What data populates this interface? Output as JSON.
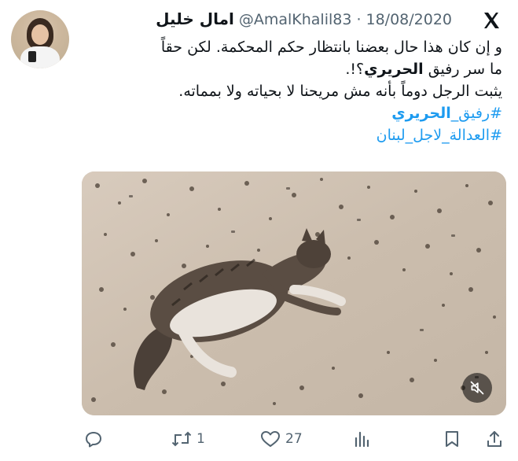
{
  "tweet": {
    "display_name": "امال خليل",
    "handle": "@AmalKhalil83",
    "separator": "·",
    "date": "18/08/2020",
    "text_line1": "و إن كان هذا حال بعضنا بانتظار حكم المحكمة. لكن حقاً",
    "text_line2_pre": "ما سر رفيق ",
    "text_line2_bold": "الحريري",
    "text_line2_post": "؟!.",
    "text_line3": "يثبت الرجل دوماً بأنه مش مريحنا لا بحياته ولا بمماته.",
    "hashtag1_pre": "#رفيق_",
    "hashtag1_bold": "الحريري",
    "hashtag2": "#العدالة_لاجل_لبنان"
  },
  "actions": {
    "reply_count": "",
    "retweet_count": "1",
    "like_count": "27"
  },
  "icons": {
    "logo": "x-logo-icon",
    "mute": "volume-mute-icon",
    "reply": "reply-icon",
    "retweet": "retweet-icon",
    "like": "heart-icon",
    "views": "views-chart-icon",
    "bookmark": "bookmark-icon",
    "share": "share-icon"
  },
  "colors": {
    "text": "#0f1419",
    "muted": "#536471",
    "link": "#1d9bf0"
  }
}
